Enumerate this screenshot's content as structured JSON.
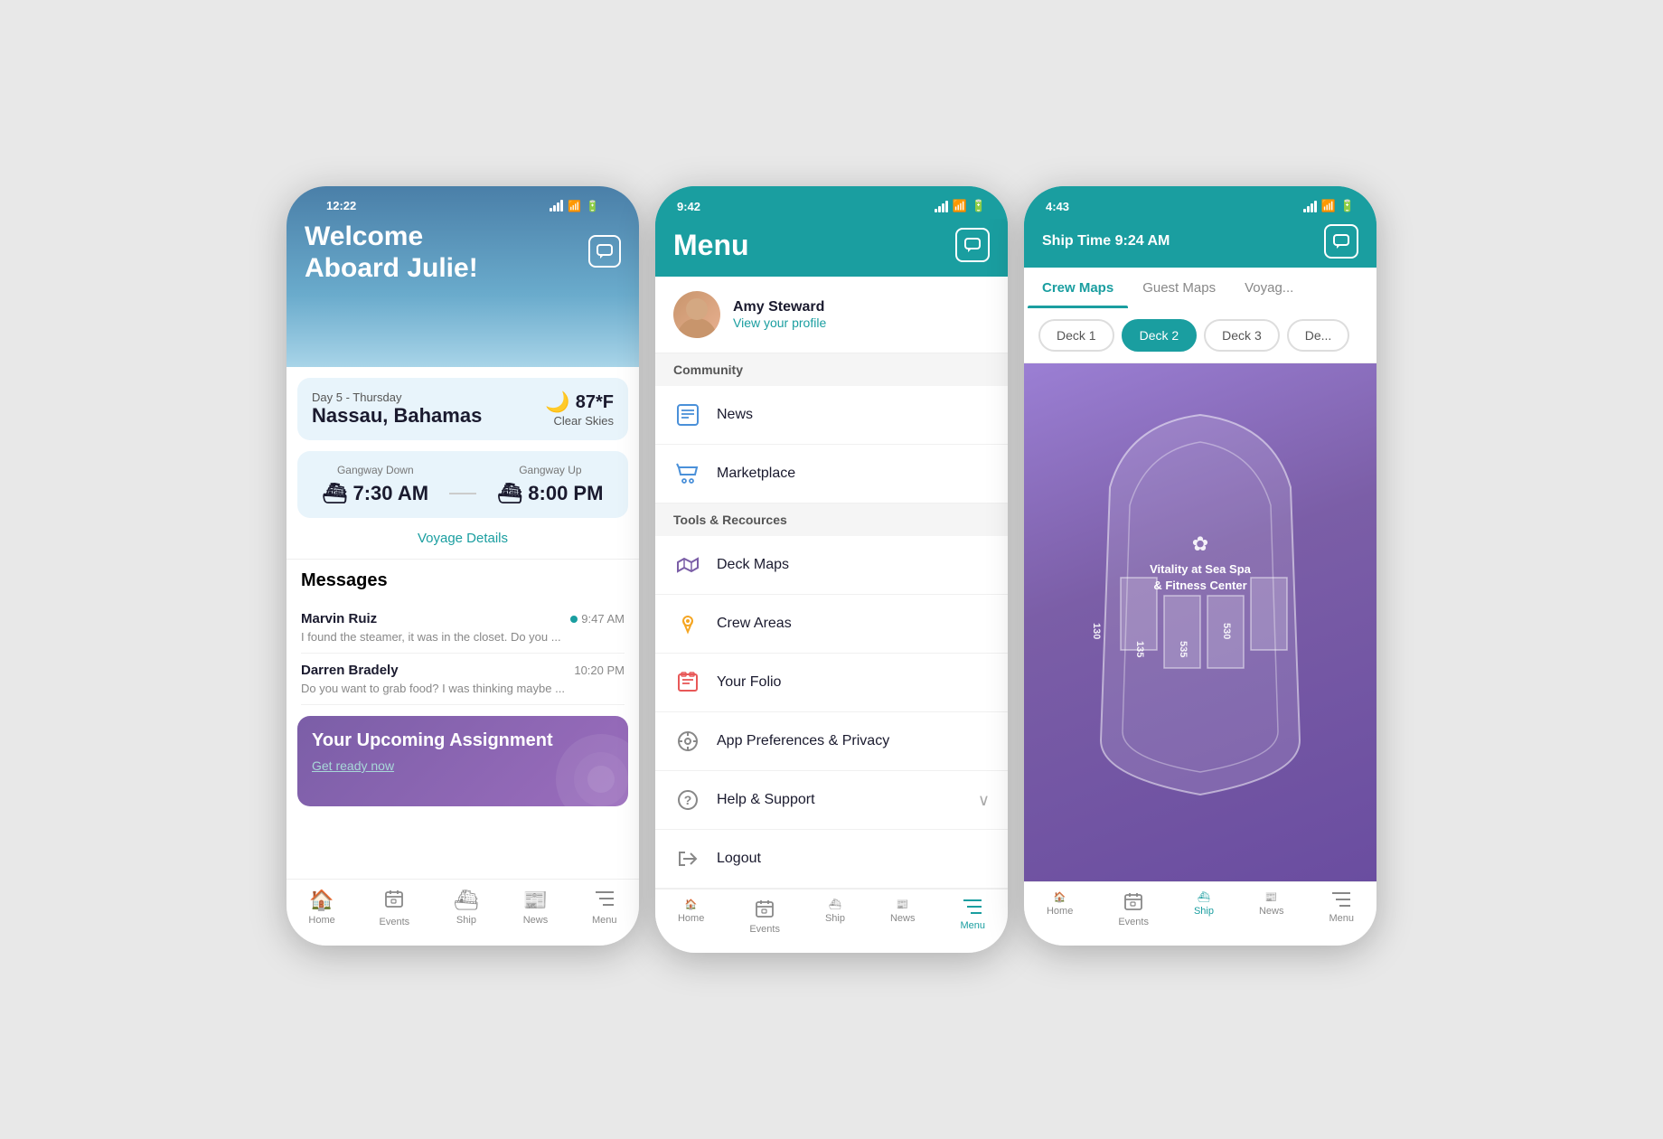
{
  "phone1": {
    "status_time": "12:22",
    "header": {
      "welcome": "Welcome",
      "subtitle": "Aboard Julie!",
      "chat_icon": "💬"
    },
    "port": {
      "day_label": "Day 5 - Thursday",
      "name": "Nassau, Bahamas",
      "temp": "87*F",
      "weather": "Clear Skies"
    },
    "gangway": {
      "down_label": "Gangway Down",
      "down_time": "7:30 AM",
      "up_label": "Gangway Up",
      "up_time": "8:00 PM"
    },
    "voyage_link": "Voyage Details",
    "messages_title": "Messages",
    "messages": [
      {
        "sender": "Marvin Ruiz",
        "time": "9:47 AM",
        "preview": "I found the steamer, it was in the closet. Do you ...",
        "unread": true
      },
      {
        "sender": "Darren Bradely",
        "time": "10:20 PM",
        "preview": "Do you want to grab food? I was thinking maybe ...",
        "unread": false
      }
    ],
    "assignment": {
      "title": "Your Upcoming Assignment",
      "link": "Get ready now"
    },
    "nav": [
      {
        "icon": "🏠",
        "label": "Home",
        "active": false
      },
      {
        "icon": "📅",
        "label": "Events",
        "active": false
      },
      {
        "icon": "🚢",
        "label": "Ship",
        "active": false
      },
      {
        "icon": "📰",
        "label": "News",
        "active": false
      },
      {
        "icon": "☰",
        "label": "Menu",
        "active": false
      }
    ]
  },
  "phone2": {
    "status_time": "9:42",
    "header": {
      "title": "Menu",
      "chat_icon": "💬"
    },
    "profile": {
      "name": "Amy Steward",
      "link": "View your profile"
    },
    "sections": [
      {
        "header": "Community",
        "items": [
          {
            "icon": "📋",
            "label": "News",
            "color": "#4a90d9"
          },
          {
            "icon": "🛍",
            "label": "Marketplace",
            "color": "#4a90d9"
          }
        ]
      },
      {
        "header": "Tools & Recources",
        "items": [
          {
            "icon": "🗺",
            "label": "Deck Maps",
            "color": "#7b5ea7"
          },
          {
            "icon": "📍",
            "label": "Crew Areas",
            "color": "#f5a623"
          },
          {
            "icon": "💳",
            "label": "Your Folio",
            "color": "#e85858"
          },
          {
            "icon": "⚙",
            "label": "App Preferences & Privacy",
            "color": "#888"
          },
          {
            "icon": "❓",
            "label": "Help & Support",
            "color": "#888",
            "has_chevron": true
          },
          {
            "icon": "🚪",
            "label": "Logout",
            "color": "#888"
          }
        ]
      }
    ],
    "nav": [
      {
        "icon": "🏠",
        "label": "Home",
        "active": false
      },
      {
        "icon": "📅",
        "label": "Events",
        "active": false
      },
      {
        "icon": "🚢",
        "label": "Ship",
        "active": false
      },
      {
        "icon": "📰",
        "label": "News",
        "active": false
      },
      {
        "icon": "☰",
        "label": "Menu",
        "active": true
      }
    ]
  },
  "phone3": {
    "status_time": "4:43",
    "ship_time": "Ship Time 9:24 AM",
    "chat_icon": "💬",
    "tabs": [
      {
        "label": "Crew Maps",
        "active": true
      },
      {
        "label": "Guest Maps",
        "active": false
      },
      {
        "label": "Voyag...",
        "active": false
      }
    ],
    "decks": [
      {
        "label": "Deck 1",
        "active": false
      },
      {
        "label": "Deck 2",
        "active": true
      },
      {
        "label": "Deck 3",
        "active": false
      },
      {
        "label": "De...",
        "active": false
      }
    ],
    "map": {
      "spa_label": "Vitality at Sea Spa\n& Fitness Center",
      "room_numbers": [
        "130",
        "135",
        "535",
        "530"
      ]
    },
    "nav": [
      {
        "icon": "🏠",
        "label": "Home",
        "active": false
      },
      {
        "icon": "📅",
        "label": "Events",
        "active": false
      },
      {
        "icon": "🚢",
        "label": "Ship",
        "active": true
      },
      {
        "icon": "📰",
        "label": "News",
        "active": false
      },
      {
        "icon": "☰",
        "label": "Menu",
        "active": false
      }
    ]
  }
}
